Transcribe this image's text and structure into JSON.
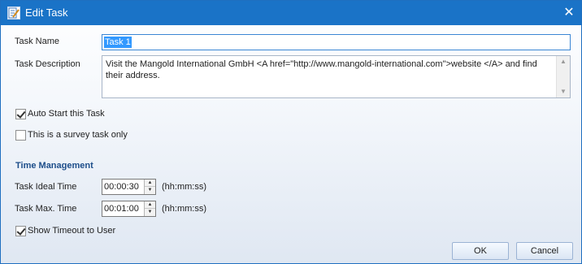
{
  "window": {
    "title": "Edit Task",
    "close_symbol": "✕",
    "icon": "edit-task-app-icon"
  },
  "task_name": {
    "label": "Task Name",
    "value": "Task 1"
  },
  "task_description": {
    "label": "Task Description",
    "value": "Visit the Mangold International GmbH <A href=\"http://www.mangold-international.com\">website </A> and find their address."
  },
  "auto_start": {
    "label": "Auto Start this Task",
    "checked": true
  },
  "survey_only": {
    "label": "This is a survey task only",
    "checked": false
  },
  "time_management": {
    "heading": "Time Management",
    "ideal": {
      "label": "Task Ideal Time",
      "value": "00:00:30",
      "unit": "(hh:mm:ss)"
    },
    "max": {
      "label": "Task Max. Time",
      "value": "00:01:00",
      "unit": "(hh:mm:ss)"
    },
    "show_timeout": {
      "label": "Show Timeout to User",
      "checked": true
    }
  },
  "buttons": {
    "ok": "OK",
    "cancel": "Cancel"
  },
  "colors": {
    "titlebar": "#1a73c7",
    "section_heading": "#1d4e8a",
    "selection": "#3399ff"
  }
}
